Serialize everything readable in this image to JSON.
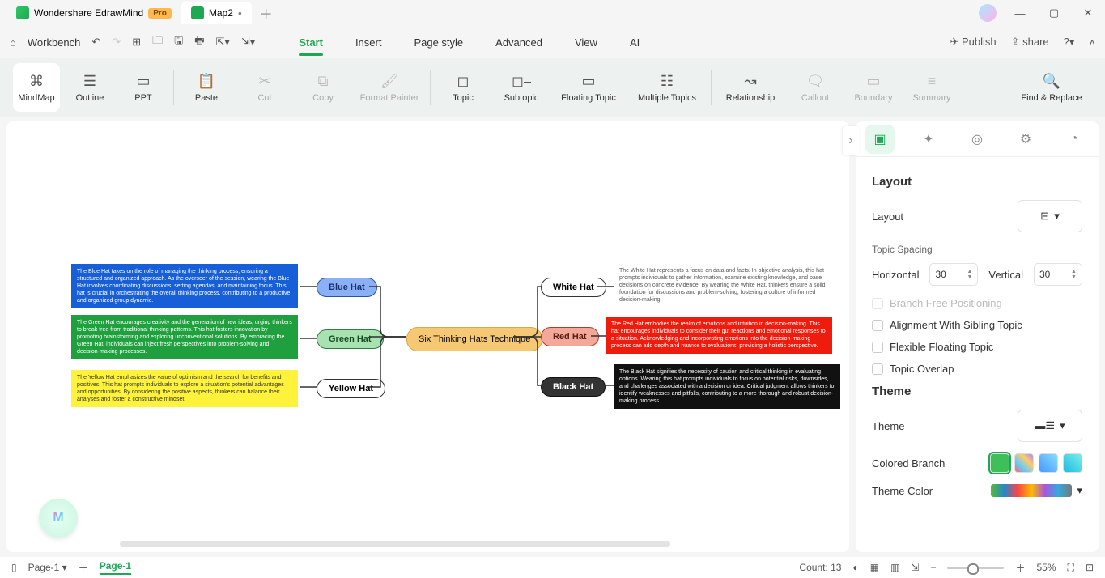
{
  "title": {
    "app": "Wondershare EdrawMind",
    "badge": "Pro",
    "doc": "Map2"
  },
  "menubar": {
    "workbench": "Workbench",
    "tabs": [
      "Start",
      "Insert",
      "Page style",
      "Advanced",
      "View",
      "AI"
    ],
    "publish": "Publish",
    "share": "share"
  },
  "toolbar": {
    "view": [
      "MindMap",
      "Outline",
      "PPT"
    ],
    "edit": [
      "Paste",
      "Cut",
      "Copy",
      "Format Painter"
    ],
    "insert": [
      "Topic",
      "Subtopic",
      "Floating Topic",
      "Multiple Topics"
    ],
    "rel": [
      "Relationship",
      "Callout",
      "Boundary",
      "Summary"
    ],
    "find": "Find & Replace"
  },
  "panel": {
    "layout_h": "Layout",
    "layout_label": "Layout",
    "spacing_h": "Topic Spacing",
    "hz": "Horizontal",
    "vt": "Vertical",
    "hz_val": "30",
    "vt_val": "30",
    "opts": [
      "Branch Free Positioning",
      "Alignment With Sibling Topic",
      "Flexible Floating Topic",
      "Topic Overlap"
    ],
    "theme_h": "Theme",
    "theme_label": "Theme",
    "cb": "Colored Branch",
    "tc": "Theme Color"
  },
  "mindmap": {
    "center": "Six Thinking Hats Technique",
    "left": [
      {
        "label": "Blue Hat",
        "desc": "The Blue Hat takes on the role of managing the thinking process, ensuring a structured and organized approach. As the overseer of the session, wearing the Blue Hat involves coordinating discussions, setting agendas, and maintaining focus. This hat is crucial in orchestrating the overall thinking process, contributing to a productive and organized group dynamic."
      },
      {
        "label": "Green Hat",
        "desc": "The Green Hat encourages creativity and the generation of new ideas, urging thinkers to break free from traditional thinking patterns. This hat fosters innovation by promoting brainstorming and exploring unconventional solutions. By embracing the Green Hat, individuals can inject fresh perspectives into problem-solving and decision-making processes."
      },
      {
        "label": "Yellow Hat",
        "desc": "The Yellow Hat emphasizes the value of optimism and the search for benefits and positives. This hat prompts individuals to explore a situation's potential advantages and opportunities. By considering the positive aspects, thinkers can balance their analyses and foster a constructive mindset."
      }
    ],
    "right": [
      {
        "label": "White Hat",
        "desc": "The White Hat represents a focus on data and facts. In objective analysis, this hat prompts individuals to gather information, examine existing knowledge, and base decisions on concrete evidence. By wearing the White Hat, thinkers ensure a solid foundation for discussions and problem-solving, fostering a culture of informed decision-making."
      },
      {
        "label": "Red Hat",
        "desc": "The Red Hat embodies the realm of emotions and intuition in decision-making. This hat encourages individuals to consider their gut reactions and emotional responses to a situation. Acknowledging and incorporating emotions into the decision-making process can add depth and nuance to evaluations, providing a holistic perspective."
      },
      {
        "label": "Black Hat",
        "desc": "The Black Hat signifies the necessity of caution and critical thinking in evaluating options. Wearing this hat prompts individuals to focus on potential risks, downsides, and challenges associated with a decision or idea. Critical judgment allows thinkers to identify weaknesses and pitfalls, contributing to a more thorough and robust decision-making process."
      }
    ]
  },
  "status": {
    "page_sel": "Page-1",
    "page_tab": "Page-1",
    "count": "Count: 13",
    "zoom": "55%"
  }
}
